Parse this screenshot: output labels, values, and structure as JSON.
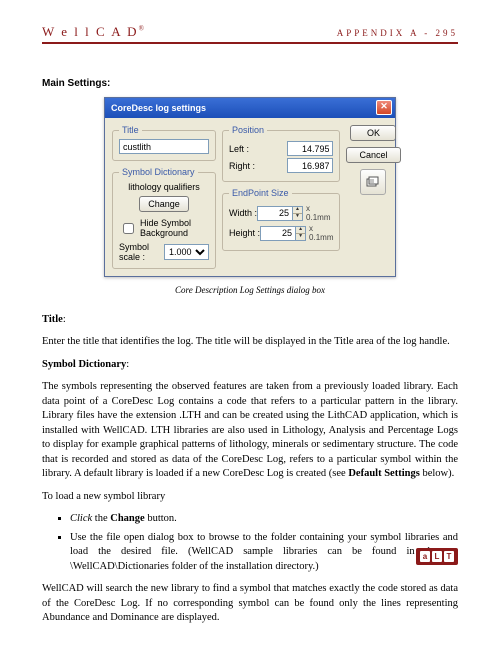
{
  "header": {
    "logo_prefix": "W e l",
    "logo_bar": " l ",
    "logo_suffix": "C A D",
    "logo_reg": "®",
    "right_text": "APPENDIX A - 295"
  },
  "section": {
    "main_settings_heading": "Main Settings:"
  },
  "dialog": {
    "title": "CoreDesc log settings",
    "close": "✕",
    "title_group": "Title",
    "title_value": "custlith",
    "symdict_group": "Symbol Dictionary",
    "lith_qualifiers": "lithology qualifiers",
    "change": "Change",
    "hide_label": "Hide Symbol Background",
    "scale_label": "Symbol scale :",
    "scale_value": "1.000",
    "position_group": "Position",
    "left_label": "Left :",
    "left_value": "14.795",
    "right_label": "Right :",
    "right_value": "16.987",
    "endpoint_group": "EndPoint Size",
    "width_label": "Width :",
    "width_value": "25",
    "height_label": "Height :",
    "height_value": "25",
    "unit": "x 0.1mm",
    "ok": "OK",
    "cancel": "Cancel"
  },
  "caption": "Core Description Log Settings dialog box",
  "body": {
    "title_heading": "Title",
    "title_para": "Enter the title that identifies the log. The title will be displayed in the Title area of the log handle.",
    "symdict_heading": "Symbol Dictionary",
    "symdict_para": "The symbols representing the observed features are taken from a previously loaded library. Each data point of a CoreDesc Log contains a code that refers to a particular pattern in the library. Library files have the extension .LTH and can be created using the LithCAD application, which is installed with WellCAD. LTH libraries are also used in Lithology, Analysis and Percentage Logs to display for example graphical patterns of lithology, minerals or sedimentary structure. The code that is recorded and stored as data of the CoreDesc Log, refers to a particular symbol within the library. A default library is loaded if a new CoreDesc Log is created (see ",
    "default_settings": "Default Settings",
    "symdict_para_end": " below).",
    "load_intro": "To load a new symbol library",
    "bullet1_em": "Click",
    "bullet1_mid": " the ",
    "bullet1_strong": "Change",
    "bullet1_end": " button.",
    "bullet2": "Use the file open dialog box to browse to the folder containing your symbol libraries and load the desired file. (WellCAD sample libraries can be found in the …\\WellCAD\\Dictionaries folder of the installation directory.)",
    "final_para": "WellCAD will search the new library to find a symbol that matches exactly the code stored as data of the CoreDesc Log. If no corresponding symbol can be found only the lines representing Abundance and Dominance are displayed."
  },
  "footer": {
    "a": "a",
    "l": "L",
    "t": "T"
  }
}
